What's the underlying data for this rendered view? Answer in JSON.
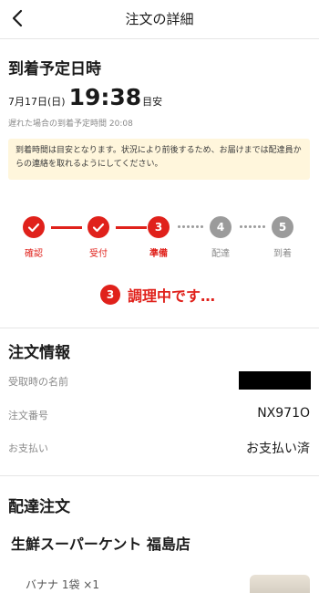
{
  "header": {
    "title": "注文の詳細"
  },
  "arrival": {
    "title": "到着予定日時",
    "date": "7月17日(日)",
    "time": "19:38",
    "unit": "目安",
    "late_note": "遅れた場合の到着予定時間 20:08",
    "notice": "到着時間は目安となります。状況により前後するため、お届けまでは配達員からの連絡を取れるようにしてください。"
  },
  "progress": {
    "steps": [
      {
        "label": "確認",
        "state": "done"
      },
      {
        "label": "受付",
        "state": "done"
      },
      {
        "label": "準備",
        "state": "current",
        "num": "3"
      },
      {
        "label": "配達",
        "state": "pending",
        "num": "4"
      },
      {
        "label": "到着",
        "state": "pending",
        "num": "5"
      }
    ],
    "status_num": "3",
    "status_text": "調理中です…"
  },
  "order_info": {
    "title": "注文情報",
    "receiver_label": "受取時の名前",
    "number_label": "注文番号",
    "number_value": "NX971O",
    "payment_label": "お支払い",
    "payment_value": "お支払い済"
  },
  "delivery": {
    "title": "配達注文",
    "store_name": "生鮮スーパーケント 福島店",
    "item": "バナナ 1袋 ×1"
  },
  "colors": {
    "accent": "#e0211b",
    "pending": "#9b9b9b",
    "notice_bg": "#fff6dc"
  }
}
